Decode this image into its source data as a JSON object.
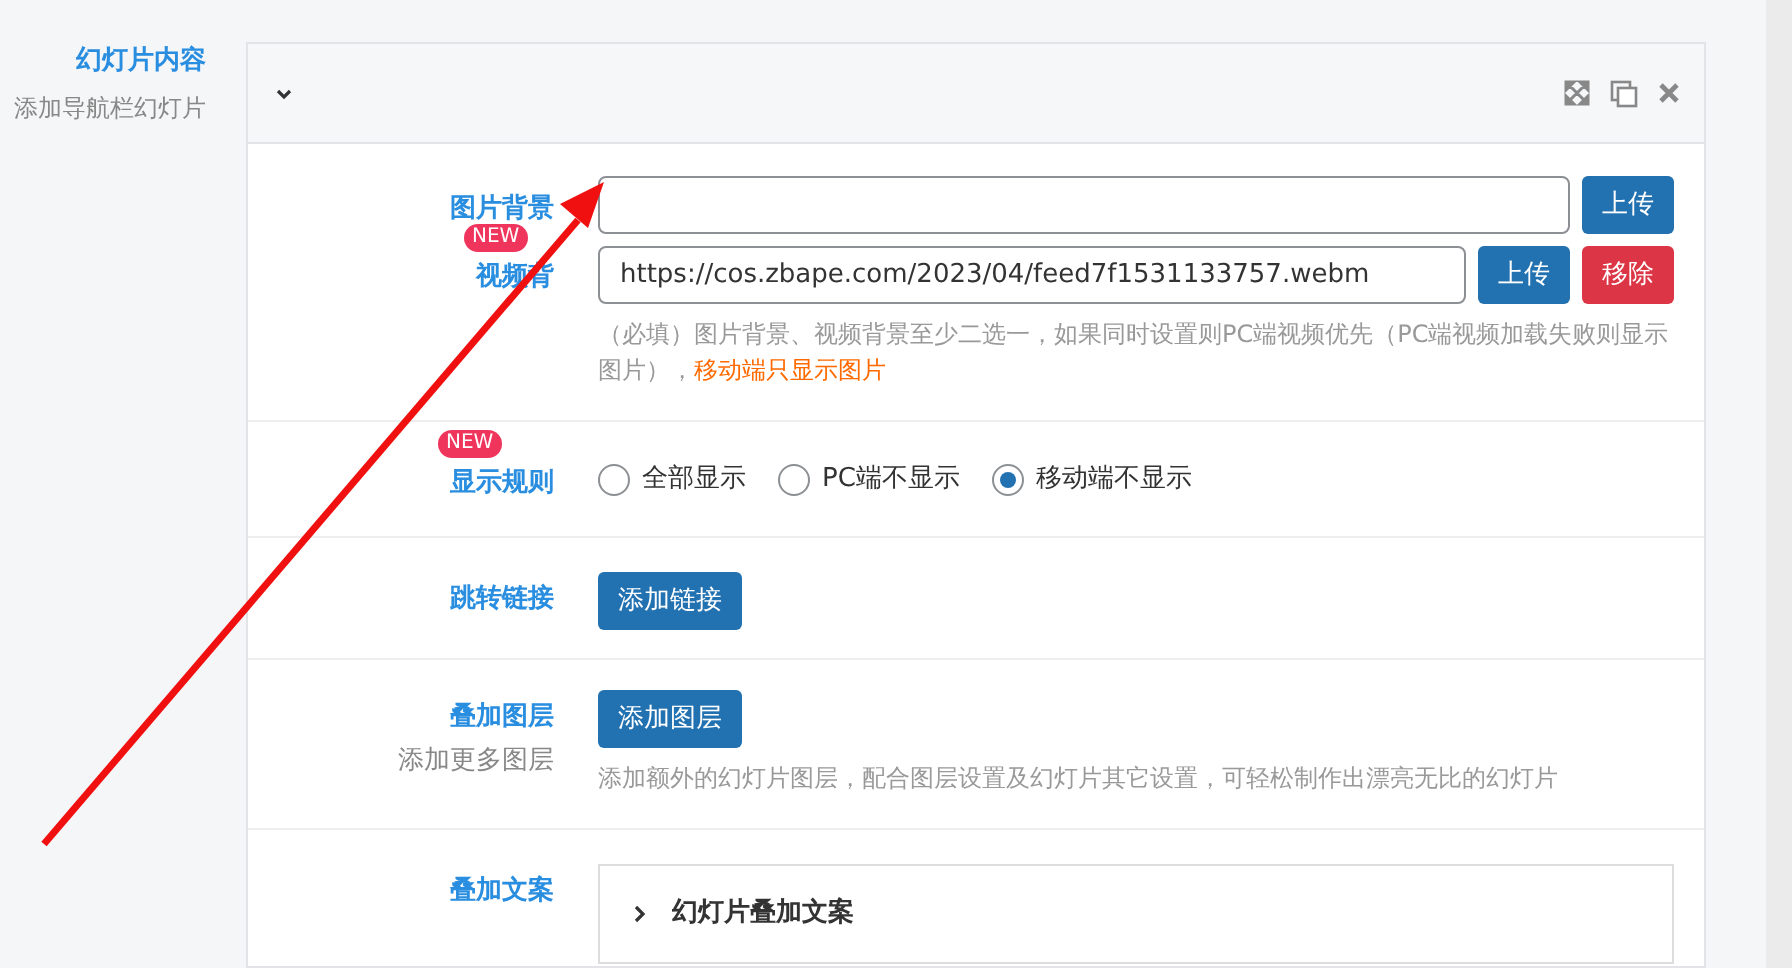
{
  "section": {
    "title": "幻灯片内容",
    "subtitle": "添加导航栏幻灯片"
  },
  "card": {
    "expanded": true
  },
  "background": {
    "image_label": "图片背景",
    "upload_image": "上传",
    "video_label": "视频背",
    "video_badge": "NEW",
    "video_value": "https://cos.zbape.com/2023/04/feed7f1531133757.webm",
    "upload_video": "上传",
    "remove_video": "移除",
    "hint": "（必填）图片背景、视频背景至少二选一，如果同时设置则PC端视频优先（PC端视频加载失败则显示图片），",
    "hint_warning": "移动端只显示图片"
  },
  "display_rule": {
    "label": "显示规则",
    "badge": "NEW",
    "options": [
      {
        "label": "全部显示",
        "selected": false
      },
      {
        "label": "PC端不显示",
        "selected": false
      },
      {
        "label": "移动端不显示",
        "selected": true
      }
    ]
  },
  "link": {
    "label": "跳转链接",
    "button": "添加链接"
  },
  "layers": {
    "label": "叠加图层",
    "sublabel": "添加更多图层",
    "button": "添加图层",
    "hint": "添加额外的幻灯片图层，配合图层设置及幻灯片其它设置，可轻松制作出漂亮无比的幻灯片"
  },
  "copy": {
    "label": "叠加文案",
    "panel_title": "幻灯片叠加文案",
    "expanded": false
  }
}
